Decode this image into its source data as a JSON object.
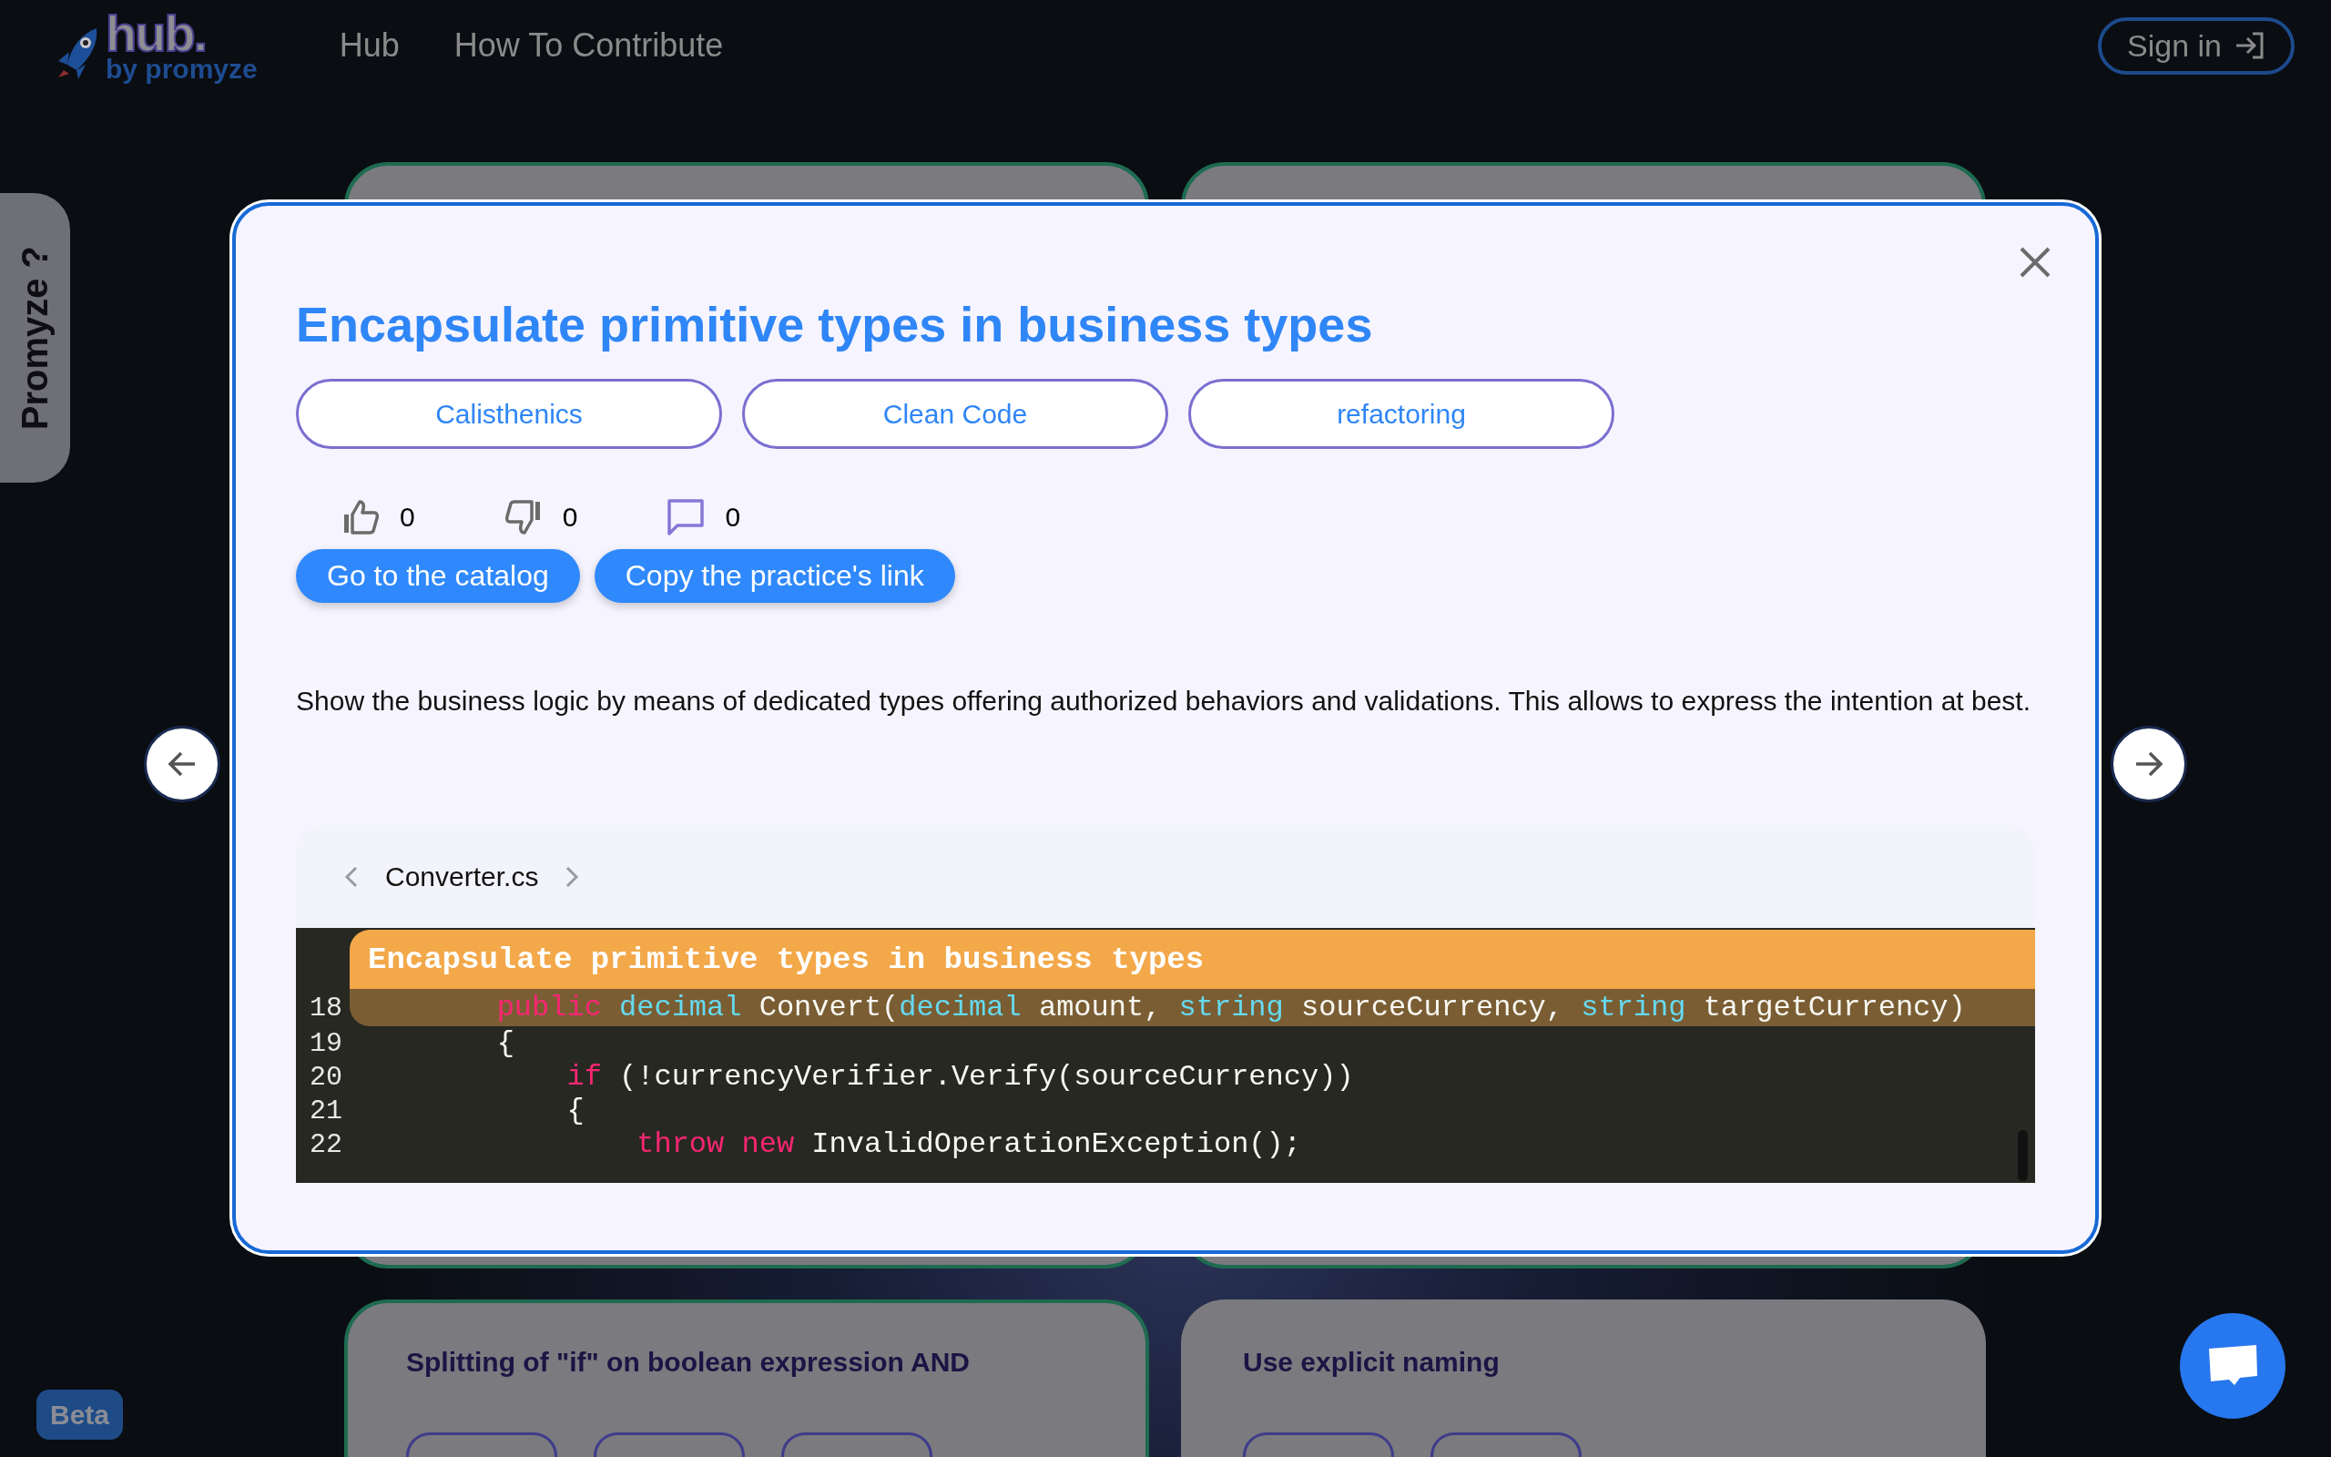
{
  "header": {
    "logo": {
      "wordmark": "hub.",
      "tagline": "by promyze"
    },
    "nav": [
      {
        "label": "Hub"
      },
      {
        "label": "How To Contribute"
      }
    ],
    "sign_in": {
      "label": "Sign in"
    }
  },
  "side_tab": {
    "label": "Promyze ?"
  },
  "cards": [
    {
      "highlighted": true
    },
    {
      "highlighted": true
    },
    {
      "highlighted": true,
      "title": "Splitting of \"if\" on boolean expression AND",
      "tags": [
        {
          "kind": "pill"
        },
        {
          "kind": "pill"
        },
        {
          "kind": "pill"
        }
      ]
    },
    {
      "highlighted": false,
      "title": "Use explicit naming",
      "tags": [
        {
          "kind": "pill"
        },
        {
          "kind": "pill"
        }
      ]
    }
  ],
  "modal": {
    "title": "Encapsulate primitive types in business types",
    "tags": [
      {
        "label": "Calisthenics"
      },
      {
        "label": "Clean Code"
      },
      {
        "label": "refactoring"
      }
    ],
    "stats": [
      {
        "kind": "likes",
        "count": "0"
      },
      {
        "kind": "dislikes",
        "count": "0"
      },
      {
        "kind": "comments",
        "count": "0"
      }
    ],
    "actions": [
      {
        "label": "Go to the catalog"
      },
      {
        "label": "Copy the practice's link"
      }
    ],
    "description": "Show the business logic by means of dedicated types offering authorized behaviors and validations. This allows to express the intention at best.",
    "code": {
      "file": "Converter.cs",
      "banner": "Encapsulate primitive types in business types",
      "lines": [
        {
          "number": "18",
          "highlighted": true,
          "tokens": [
            {
              "kind": "keyword",
              "text": "        public"
            },
            {
              "kind": "type",
              "text": " decimal"
            },
            {
              "kind": "plain",
              "text": " Convert("
            },
            {
              "kind": "type",
              "text": "decimal"
            },
            {
              "kind": "plain",
              "text": " amount, "
            },
            {
              "kind": "type",
              "text": "string"
            },
            {
              "kind": "plain",
              "text": " sourceCurrency, "
            },
            {
              "kind": "type",
              "text": "string"
            },
            {
              "kind": "plain",
              "text": " targetCurrency)"
            }
          ]
        },
        {
          "number": "19",
          "highlighted": false,
          "tokens": [
            {
              "kind": "plain",
              "text": "        {"
            }
          ]
        },
        {
          "number": "20",
          "highlighted": false,
          "tokens": [
            {
              "kind": "keyword",
              "text": "            if"
            },
            {
              "kind": "plain",
              "text": " (!currencyVerifier.Verify(sourceCurrency))"
            }
          ]
        },
        {
          "number": "21",
          "highlighted": false,
          "tokens": [
            {
              "kind": "plain",
              "text": "            {"
            }
          ]
        },
        {
          "number": "22",
          "highlighted": false,
          "tokens": [
            {
              "kind": "keyword",
              "text": "                throw new"
            },
            {
              "kind": "plain",
              "text": " InvalidOperationException();"
            }
          ]
        }
      ]
    }
  },
  "beta_badge": {
    "label": "Beta"
  }
}
